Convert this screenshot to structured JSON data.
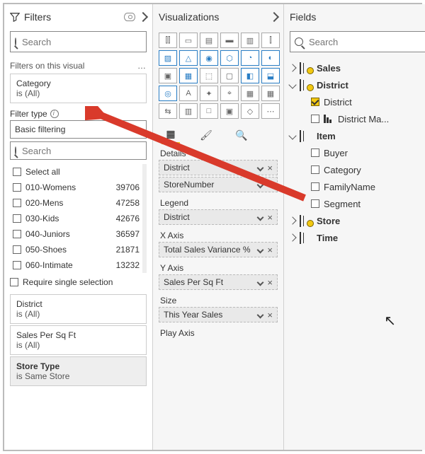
{
  "filters": {
    "title": "Filters",
    "search_ph": "Search",
    "section": "Filters on this visual",
    "category_card": {
      "name": "Category",
      "state": "is (All)"
    },
    "filter_type_lbl": "Filter type",
    "filter_type_val": "Basic filtering",
    "values_search_ph": "Search",
    "select_all": "Select all",
    "items": [
      {
        "label": "010-Womens",
        "count": "39706"
      },
      {
        "label": "020-Mens",
        "count": "47258"
      },
      {
        "label": "030-Kids",
        "count": "42676"
      },
      {
        "label": "040-Juniors",
        "count": "36597"
      },
      {
        "label": "050-Shoes",
        "count": "21871"
      },
      {
        "label": "060-Intimate",
        "count": "13232"
      }
    ],
    "require_single": "Require single selection",
    "district_card": {
      "name": "District",
      "state": "is (All)"
    },
    "spsf_card": {
      "name": "Sales Per Sq Ft",
      "state": "is (All)"
    },
    "storetype_card": {
      "name": "Store Type",
      "state": "is Same Store"
    }
  },
  "viz": {
    "title": "Visualizations",
    "wells": {
      "details_lbl": "Details",
      "details": [
        "District",
        "StoreNumber"
      ],
      "legend_lbl": "Legend",
      "legend": [
        "District"
      ],
      "x_lbl": "X Axis",
      "x": [
        "Total Sales Variance %"
      ],
      "y_lbl": "Y Axis",
      "y": [
        "Sales Per Sq Ft"
      ],
      "size_lbl": "Size",
      "size": [
        "This Year Sales"
      ],
      "play_lbl": "Play Axis"
    }
  },
  "fields": {
    "title": "Fields",
    "search_ph": "Search",
    "tables": [
      {
        "name": "Sales",
        "marked": true,
        "expanded": false
      },
      {
        "name": "District",
        "marked": true,
        "expanded": true,
        "children": [
          {
            "name": "District",
            "checked": true,
            "type": "field"
          },
          {
            "name": "District Ma...",
            "checked": false,
            "type": "hier"
          }
        ]
      },
      {
        "name": "Item",
        "marked": false,
        "expanded": true,
        "children": [
          {
            "name": "Buyer",
            "checked": false
          },
          {
            "name": "Category",
            "checked": false
          },
          {
            "name": "FamilyName",
            "checked": false
          },
          {
            "name": "Segment",
            "checked": false
          }
        ]
      },
      {
        "name": "Store",
        "marked": true,
        "expanded": false
      },
      {
        "name": "Time",
        "marked": false,
        "expanded": false
      }
    ]
  },
  "dots": "…"
}
